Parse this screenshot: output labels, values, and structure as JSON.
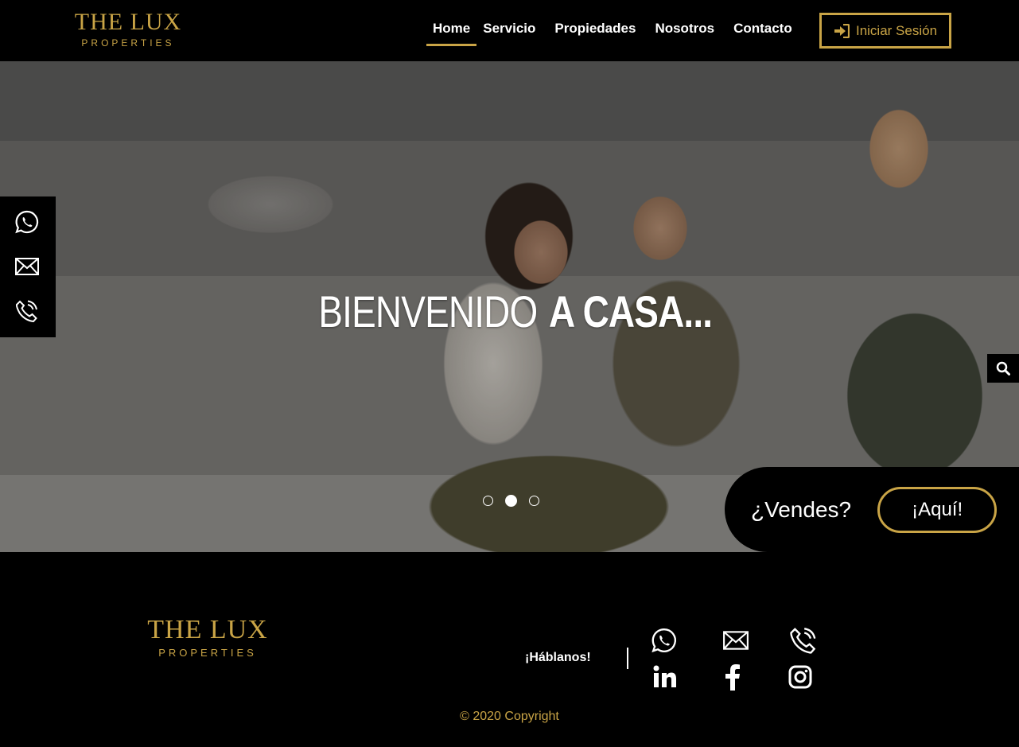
{
  "header": {
    "logo": {
      "brand": "THE LUX",
      "sub": "PROPERTIES"
    },
    "nav": [
      {
        "label": "Home",
        "active": true
      },
      {
        "label": "Servicio"
      },
      {
        "label": "Propiedades"
      },
      {
        "label": "Nosotros"
      },
      {
        "label": "Contacto"
      }
    ],
    "login_label": "Iniciar Sesión"
  },
  "hero": {
    "title_light": "BIENVENIDO",
    "title_bold": "A CASA...",
    "slides": 3,
    "active_slide": 2,
    "sell_label": "¿Vendes?",
    "sell_button": "¡Aquí!"
  },
  "side_contact": [
    "whatsapp-icon",
    "mail-icon",
    "phone-icon"
  ],
  "footer": {
    "logo": {
      "brand": "THE LUX",
      "sub": "PROPERTIES"
    },
    "talk_label": "¡Háblanos!",
    "icons": [
      "whatsapp-icon",
      "mail-icon",
      "phone-icon",
      "linkedin-icon",
      "facebook-icon",
      "instagram-icon"
    ],
    "copyright": "© 2020 Copyright"
  },
  "colors": {
    "gold": "#c9a446",
    "black": "#000000",
    "white": "#ffffff"
  }
}
